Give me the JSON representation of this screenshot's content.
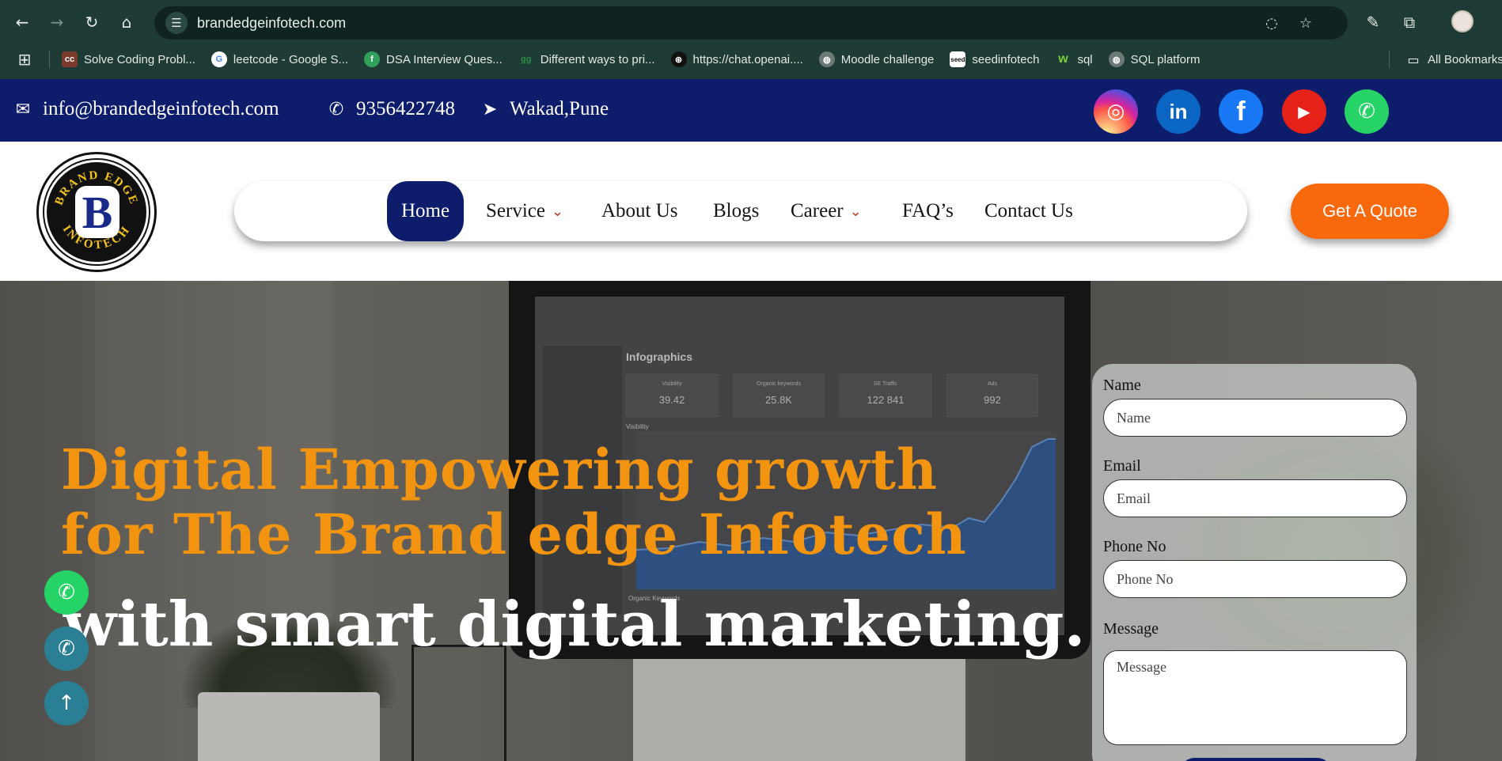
{
  "browser": {
    "url": "brandedgeinfotech.com",
    "back_icon": "arrow-left-icon",
    "bookmarks": [
      {
        "label": "Solve Coding Probl...",
        "icon": "cc",
        "color": "#7a3b2c"
      },
      {
        "label": "leetcode - Google S...",
        "icon": "G",
        "color": "#ffffff"
      },
      {
        "label": "DSA Interview Ques...",
        "icon": "f",
        "color": "#31a05a"
      },
      {
        "label": "Different ways to pri...",
        "icon": "gg",
        "color": "#2f8d46"
      },
      {
        "label": "https://chat.openai....",
        "icon": "⊛",
        "color": "#111111"
      },
      {
        "label": "Moodle challenge",
        "icon": "◍",
        "color": "#6b7a77"
      },
      {
        "label": "seedinfotech",
        "icon": "seed",
        "color": "#ffffff"
      },
      {
        "label": "sql",
        "icon": "w",
        "color": "#1f3b35"
      },
      {
        "label": "SQL platform",
        "icon": "◍",
        "color": "#6b7a77"
      }
    ],
    "all_bookmarks": "All Bookmarks"
  },
  "topbar": {
    "email": "info@brandedgeinfotech.com",
    "phone": "9356422748",
    "location": "Wakad,Pune",
    "socials": [
      {
        "name": "instagram",
        "glyph": "◎",
        "color": "#d6249f"
      },
      {
        "name": "linkedin",
        "glyph": "in",
        "color": "#0a66c2"
      },
      {
        "name": "facebook",
        "glyph": "f",
        "color": "#1877f2"
      },
      {
        "name": "youtube",
        "glyph": "▶",
        "color": "#e62117"
      },
      {
        "name": "whatsapp",
        "glyph": "✆",
        "color": "#25d366"
      }
    ]
  },
  "nav": {
    "home": "Home",
    "service": "Service",
    "about": "About Us",
    "blogs": "Blogs",
    "career": "Career",
    "faq": "FAQ’s",
    "contact": "Contact Us",
    "quote": "Get A Quote"
  },
  "hero": {
    "line1": "Digital Empowering growth",
    "line2": "for The Brand edge Infotech",
    "line3": "with smart digital marketing.",
    "screen": {
      "title": "Infographics",
      "cards": [
        {
          "label": "Visibility",
          "value": "39.42"
        },
        {
          "label": "Organic keywords",
          "value": "25.8K"
        },
        {
          "label": "SE Traffic",
          "value": "122 841"
        },
        {
          "label": "Ads",
          "value": "992"
        }
      ],
      "visibility_label": "Visibility",
      "organic_label": "Organic Keywords"
    }
  },
  "form": {
    "name_label": "Name",
    "name_placeholder": "Name",
    "email_label": "Email",
    "email_placeholder": "Email",
    "phone_label": "Phone No",
    "phone_placeholder": "Phone No",
    "message_label": "Message",
    "message_placeholder": "Message"
  },
  "logo": {
    "top_text": "BRAND EDGE",
    "bottom_text": "INFOTECH",
    "letter": "B"
  },
  "colors": {
    "topbar": "#0d1c6b",
    "accent": "#f8680c",
    "headline": "#f29410"
  }
}
